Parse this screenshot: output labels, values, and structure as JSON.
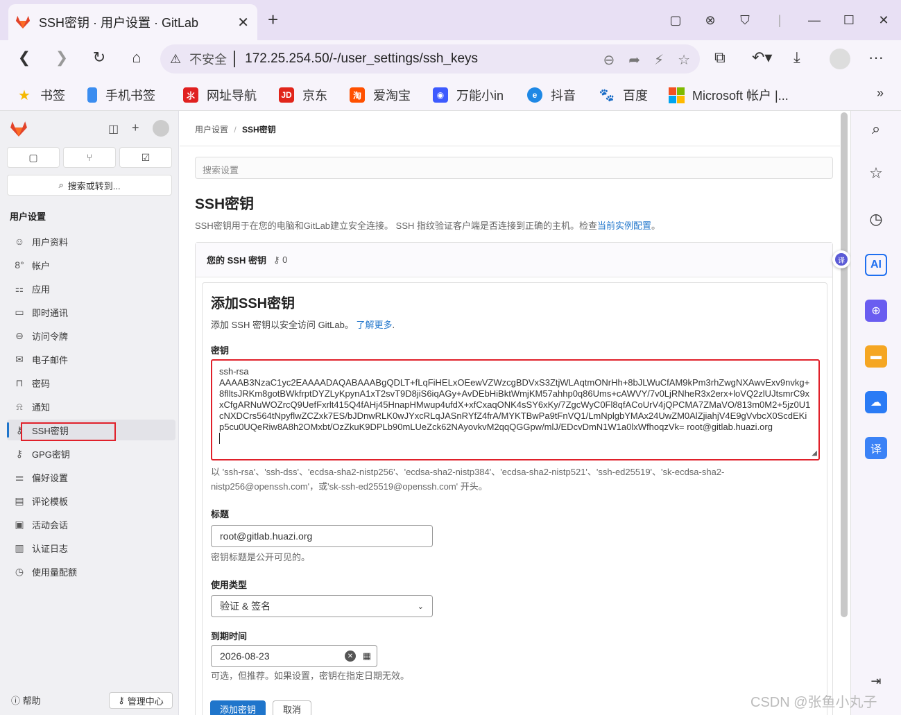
{
  "browser": {
    "tab_title": "SSH密钥 · 用户设置 · GitLab",
    "security_label": "不安全",
    "url": "172.25.254.50/-/user_settings/ssh_keys",
    "bookmarks": [
      {
        "label": "书签",
        "icon": "star-icon",
        "color": "#f5b800"
      },
      {
        "label": "手机书签",
        "icon": "phone-icon",
        "color": "#3b8df0"
      },
      {
        "label": "网址导航",
        "icon": "navigation-icon",
        "color": "#e02020"
      },
      {
        "label": "京东",
        "icon": "jd-icon",
        "color": "#e1251b"
      },
      {
        "label": "爱淘宝",
        "icon": "taobao-icon",
        "color": "#ff5000"
      },
      {
        "label": "万能小in",
        "icon": "robot-icon",
        "color": "#3d5afe"
      },
      {
        "label": "抖音",
        "icon": "edge-icon",
        "color": "#1e88e5"
      },
      {
        "label": "百度",
        "icon": "baidu-icon",
        "color": "#2932e1"
      },
      {
        "label": "Microsoft 帐户 |...",
        "icon": "microsoft-icon",
        "color": "#f25022"
      }
    ],
    "more": "»"
  },
  "gitlab": {
    "sidebar": {
      "search_label": "搜索或转到...",
      "section_title": "用户设置",
      "items": [
        {
          "label": "用户资料",
          "icon": "profile-icon",
          "glyph": "☺"
        },
        {
          "label": "帐户",
          "icon": "account-icon",
          "glyph": "8°"
        },
        {
          "label": "应用",
          "icon": "applications-icon",
          "glyph": "⚏"
        },
        {
          "label": "即时通讯",
          "icon": "chat-icon",
          "glyph": "▭"
        },
        {
          "label": "访问令牌",
          "icon": "token-icon",
          "glyph": "⊖"
        },
        {
          "label": "电子邮件",
          "icon": "email-icon",
          "glyph": "✉"
        },
        {
          "label": "密码",
          "icon": "lock-icon",
          "glyph": "🔒"
        },
        {
          "label": "通知",
          "icon": "bell-icon",
          "glyph": "🔔"
        },
        {
          "label": "SSH密钥",
          "icon": "key-icon",
          "glyph": "⚷"
        },
        {
          "label": "GPG密钥",
          "icon": "gpg-key-icon",
          "glyph": "⚷"
        },
        {
          "label": "偏好设置",
          "icon": "preferences-icon",
          "glyph": "⚌"
        },
        {
          "label": "评论模板",
          "icon": "comment-icon",
          "glyph": "▤"
        },
        {
          "label": "活动会话",
          "icon": "sessions-icon",
          "glyph": "▣"
        },
        {
          "label": "认证日志",
          "icon": "log-icon",
          "glyph": "▥"
        },
        {
          "label": "使用量配额",
          "icon": "quota-icon",
          "glyph": "◷"
        }
      ],
      "help": "帮助",
      "admin": "管理中心"
    },
    "breadcrumb": {
      "parent": "用户设置",
      "separator": "/",
      "current": "SSH密钥"
    },
    "settings_search_placeholder": "搜索设置",
    "page_title": "SSH密钥",
    "page_desc": "SSH密钥用于在您的电脑和GitLab建立安全连接。 SSH 指纹验证客户端是否连接到正确的主机。检查",
    "page_desc_link": "当前实例配置",
    "page_desc_end": "。",
    "card": {
      "title": "您的 SSH 密钥",
      "count": "0",
      "form_title": "添加SSH密钥",
      "form_desc": "添加 SSH 密钥以安全访问 GitLab。",
      "learn_more": "了解更多",
      "learn_more_end": ".",
      "key_label": "密钥",
      "key_value": "ssh-rsa\nAAAAB3NzaC1yc2EAAAADAQABAAABgQDLT+fLqFiHELxOEewVZWzcgBDVxS3ZtjWLAqtmONrHh+8bJLWuCfAM9kPm3rhZwgNXAwvExv9nvkg+8flltsJRKm8gotBWkfrptDYZLyKpynA1xT2svT9D8jiS6iqAGy+AvDEbHiBktWmjKM57ahhp0q86Ums+cAWVY/7v0LjRNheR3x2erx+loVQ2zlUJtsmrC9xxCfgARNuWOZrcQ9UefFxrlt415Q4fAHj45HnapHMwup4ufdX+xfCxaqONK4sSY6xKy/7ZgcWyC0Fl8qfACoUrV4jQPCMA7ZMaVO/813m0M2+5jz0U1cNXDCrs564tNpyflwZCZxk7ES/bJDnwRLK0wJYxcRLqJASnRYfZ4frA/MYKTBwPa9tFnVQ1/LmNplgbYMAx24UwZM0AlZjiahjV4E9gVvbcX0ScdEKip5cu0UQeRiw8A8h2OMxbt/OzZkuK9DPLb90mLUeZck62NAyovkvM2qqQGGpw/mlJ/EDcvDmN1W1a0lxWfhoqzVk= root@gitlab.huazi.org",
      "key_hint": "以 'ssh-rsa'、'ssh-dss'、'ecdsa-sha2-nistp256'、'ecdsa-sha2-nistp384'、'ecdsa-sha2-nistp521'、'ssh-ed25519'、'sk-ecdsa-sha2-nistp256@openssh.com'，或'sk-ssh-ed25519@openssh.com' 开头。",
      "title_label": "标题",
      "title_value": "root@gitlab.huazi.org",
      "title_hint": "密钥标题是公开可见的。",
      "usage_label": "使用类型",
      "usage_value": "验证 & 签名",
      "expires_label": "到期时间",
      "expires_value": "2026-08-23",
      "expires_hint": "可选，但推荐。如果设置，密钥在指定日期无效。",
      "submit": "添加密钥",
      "cancel": "取消"
    }
  },
  "colors": {
    "accent": "#1f75cb",
    "highlight": "#e0202a",
    "gitlab_orange": "#e24329"
  },
  "watermark": "CSDN @张鱼小丸子"
}
